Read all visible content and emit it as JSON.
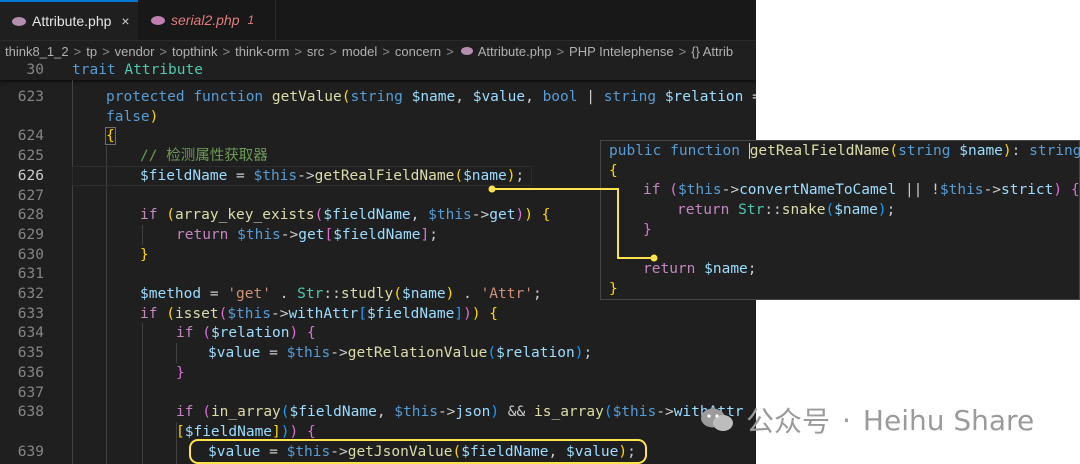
{
  "tabs": [
    {
      "label": "Attribute.php",
      "close": "×"
    },
    {
      "label": "serial2.php",
      "count": "1"
    }
  ],
  "breadcrumb": [
    "think8_1_2",
    "tp",
    "vendor",
    "topthink",
    "think-orm",
    "src",
    "model",
    "concern",
    "Attribute.php",
    "PHP Intelephense",
    "{} Attrib"
  ],
  "breadcrumb_sep": ">",
  "sticky": {
    "line": "30",
    "kw": "trait",
    "name": "Attribute"
  },
  "lines": [
    "623",
    "",
    "624",
    "625",
    "626",
    "627",
    "628",
    "629",
    "630",
    "631",
    "632",
    "633",
    "634",
    "635",
    "636",
    "637",
    "638",
    "",
    "639"
  ],
  "code": {
    "l623a_kw1": "protected",
    "l623a_kw2": "function",
    "l623a_fn": "getValue",
    "l623a_t1": "string",
    "l623a_v1": "$name",
    "l623a_v2": "$value",
    "l623a_t2": "bool",
    "l623a_bar": "|",
    "l623a_t3": "string",
    "l623a_v3": "$relation",
    "l623a_eq": "=",
    "l623b_false": "false",
    "l625_comment": "// 检测属性获取器",
    "l626_var": "$fieldName",
    "l626_eq": "=",
    "l626_this": "$this",
    "l626_arrow": "->",
    "l626_fn": "getRealFieldName",
    "l626_arg": "$name",
    "l628_if": "if",
    "l628_fn": "array_key_exists",
    "l628_a1": "$fieldName",
    "l628_this": "$this",
    "l628_get": "get",
    "l629_ret": "return",
    "l629_this": "$this",
    "l629_get": "get",
    "l629_idx": "$fieldName",
    "l632_var": "$method",
    "l632_str1": "'get'",
    "l632_cls": "Str",
    "l632_fn": "studly",
    "l632_arg": "$name",
    "l632_str2": "'Attr'",
    "l633_if": "if",
    "l633_fn": "isset",
    "l633_this": "$this",
    "l633_prop": "withAttr",
    "l633_idx": "$fieldName",
    "l634_if": "if",
    "l634_var": "$relation",
    "l635_var": "$value",
    "l635_this": "$this",
    "l635_fn": "getRelationValue",
    "l635_arg": "$relation",
    "l638_if": "if",
    "l638_fn1": "in_array",
    "l638_a1": "$fieldName",
    "l638_this": "$this",
    "l638_json": "json",
    "l638_fn2": "is_array",
    "l638_this2": "$this",
    "l638_prop": "withAttr",
    "l638b_idx": "$fieldName",
    "l639_var": "$value",
    "l639_this": "$this",
    "l639_fn": "getJsonValue",
    "l639_a1": "$fieldName",
    "l639_a2": "$value"
  },
  "hover": {
    "kw1": "public",
    "kw2": "function",
    "fn": "getRealFieldName",
    "t1": "string",
    "v1": "$name",
    "rt": "string",
    "if": "if",
    "this1": "$this",
    "fn2": "convertNameToCamel",
    "or": "||",
    "not": "!",
    "this2": "$this",
    "strict": "strict",
    "ret1": "return",
    "cls": "Str",
    "fn3": "snake",
    "arg": "$name",
    "ret2": "return",
    "arg2": "$name"
  },
  "watermark": {
    "brand": "公众号",
    "dot": "·",
    "name": "Heihu Share"
  },
  "colors": {
    "annotation": "#ffe34d",
    "editor_bg": "#1f1f1f",
    "accent": "#0078d4"
  }
}
